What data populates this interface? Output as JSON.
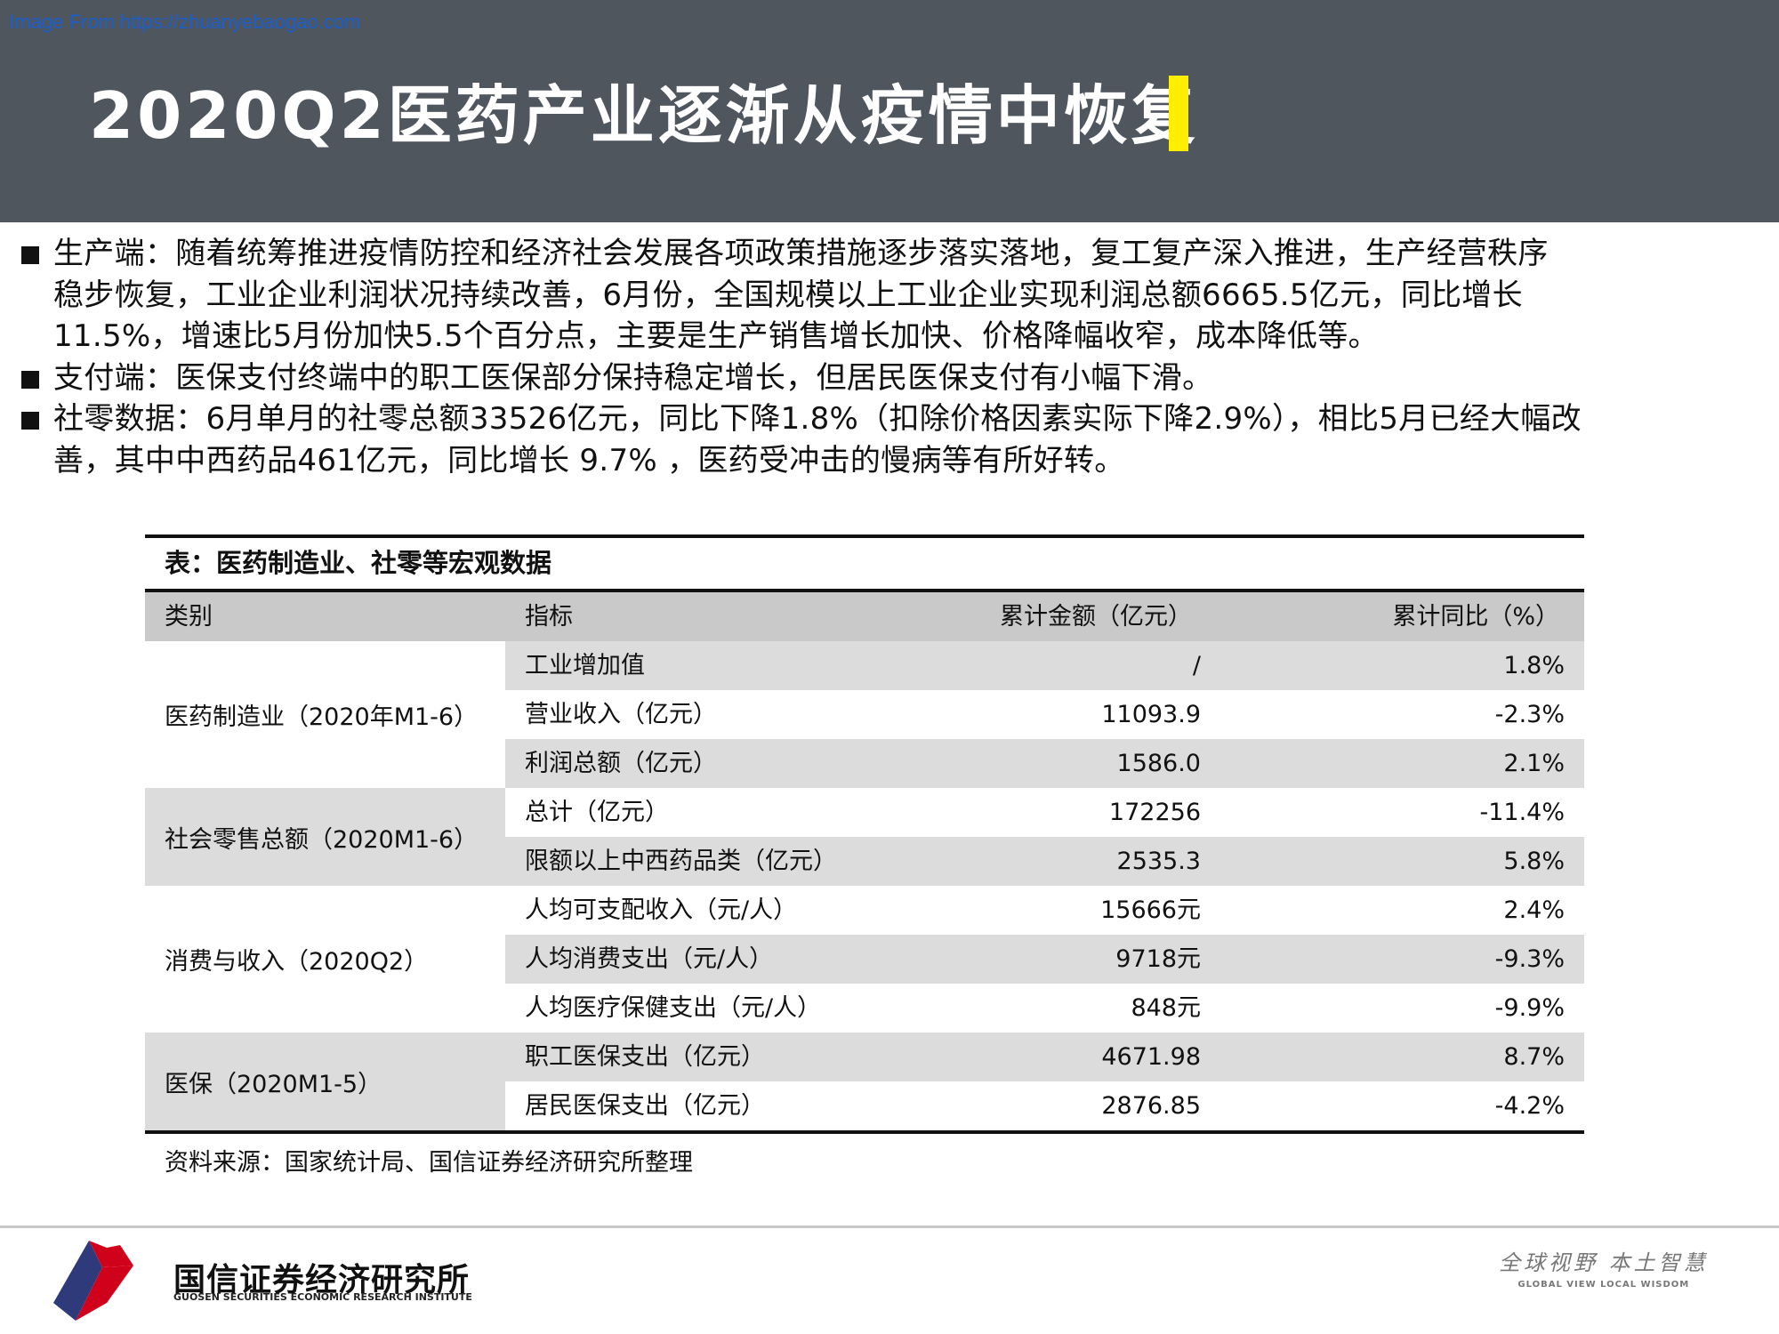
{
  "watermark": "Image From https://zhuanyebaogao.com",
  "title": "2020Q2医药产业逐渐从疫情中恢复",
  "bullets": [
    {
      "lines": [
        "生产端：随着统筹推进疫情防控和经济社会发展各项政策措施逐步落实落地，复工复产深入推进，生产经营秩序",
        "稳步恢复，工业企业利润状况持续改善，6月份，全国规模以上工业企业实现利润总额6665.5亿元，同比增长",
        "11.5%，增速比5月份加快5.5个百分点，主要是生产销售增长加快、价格降幅收窄，成本降低等。"
      ]
    },
    {
      "lines": [
        "支付端：医保支付终端中的职工医保部分保持稳定增长，但居民医保支付有小幅下滑。"
      ]
    },
    {
      "lines": [
        "社零数据：6月单月的社零总额33526亿元，同比下降1.8%（扣除价格因素实际下降2.9%），相比5月已经大幅改",
        "善，其中中西药品461亿元，同比增长 9.7% ，医药受冲击的慢病等有所好转。"
      ]
    }
  ],
  "table": {
    "caption": "表：医药制造业、社零等宏观数据",
    "headers": [
      "类别",
      "指标",
      "累计金额（亿元）",
      "累计同比（%）"
    ],
    "groups": [
      {
        "category": "医药制造业（2020年M1-6）",
        "rows": [
          [
            "工业增加值",
            "/",
            "1.8%"
          ],
          [
            "营业收入（亿元）",
            "11093.9",
            "-2.3%"
          ],
          [
            "利润总额（亿元）",
            "1586.0",
            "2.1%"
          ]
        ]
      },
      {
        "category": "社会零售总额（2020M1-6）",
        "rows": [
          [
            "总计（亿元）",
            "172256",
            "-11.4%"
          ],
          [
            "限额以上中西药品类（亿元）",
            "2535.3",
            "5.8%"
          ]
        ]
      },
      {
        "category": "消费与收入（2020Q2）",
        "rows": [
          [
            "人均可支配收入（元/人）",
            "15666元",
            "2.4%"
          ],
          [
            "人均消费支出（元/人）",
            "9718元",
            "-9.3%"
          ],
          [
            "人均医疗保健支出（元/人）",
            "848元",
            "-9.9%"
          ]
        ]
      },
      {
        "category": "医保（2020M1-5）",
        "rows": [
          [
            "职工医保支出（亿元）",
            "4671.98",
            "8.7%"
          ],
          [
            "居民医保支出（亿元）",
            "2876.85",
            "-4.2%"
          ]
        ]
      }
    ],
    "source": "资料来源：国家统计局、国信证券经济研究所整理"
  },
  "footer": {
    "logo_cn": "国信证券经济研究所",
    "logo_en": "GUOSEN SECURITIES ECONOMIC RESEARCH INSTITUTE",
    "slogan_cn": "全球视野 本土智慧",
    "slogan_en": "GLOBAL VIEW  LOCAL WISDOM"
  },
  "colors": {
    "header_bg": "#50565e",
    "accent_yellow": "#ffee00",
    "logo_red": "#d0021b",
    "logo_blue": "#2e3a7a"
  }
}
